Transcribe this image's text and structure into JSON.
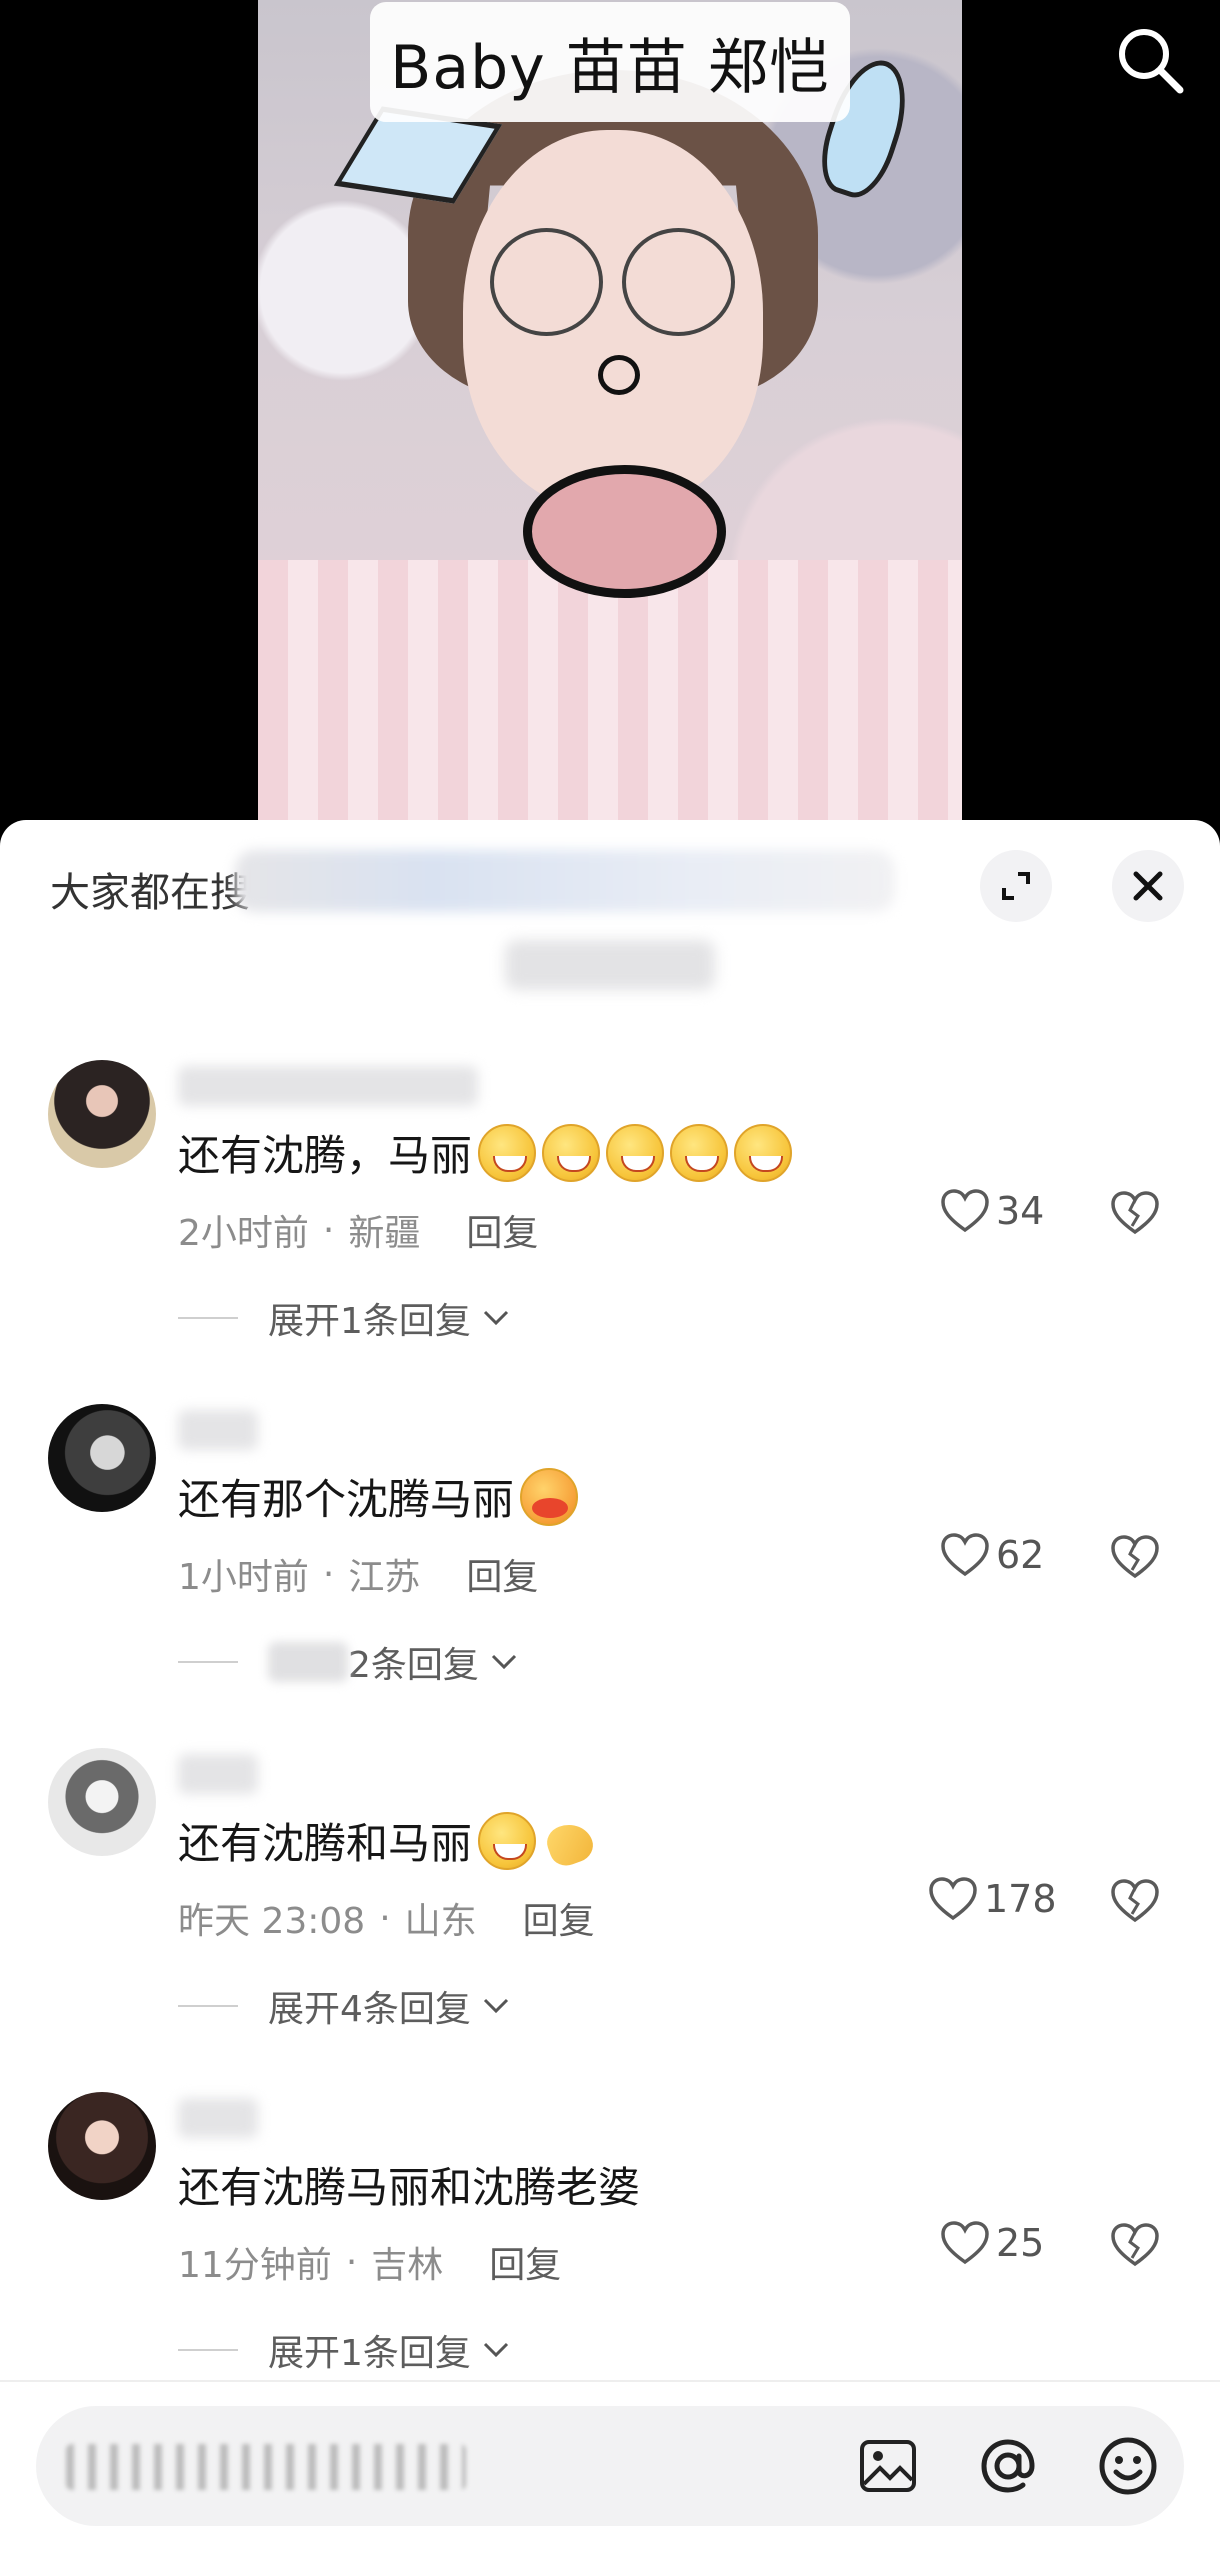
{
  "video": {
    "title": "Baby 苗苗 郑恺"
  },
  "icons": {
    "search": "search-icon",
    "expand": "expand-icon",
    "close": "close-icon",
    "like": "heart-icon",
    "dislike": "broken-heart-icon",
    "image": "image-icon",
    "at": "at-icon",
    "emoji": "smiley-icon"
  },
  "sheet": {
    "hint_prefix": "大家都在搜"
  },
  "comments": [
    {
      "text": "还有沈腾，马丽",
      "time": "2小时前",
      "location": "新疆",
      "reply_label": "回复",
      "likes": "34",
      "expand_label": "展开1条回复"
    },
    {
      "text": "还有那个沈腾马丽",
      "time": "1小时前",
      "location": "江苏",
      "reply_label": "回复",
      "likes": "62",
      "expand_label": "2条回复"
    },
    {
      "text": "还有沈腾和马丽",
      "time": "昨天 23:08",
      "location": "山东",
      "reply_label": "回复",
      "likes": "178",
      "expand_label": "展开4条回复"
    },
    {
      "text": "还有沈腾马丽和沈腾老婆",
      "time": "11分钟前",
      "location": "吉林",
      "reply_label": "回复",
      "likes": "25",
      "expand_label": "展开1条回复"
    }
  ],
  "colors": {
    "like_stroke": "#5a5a5a",
    "sheet_bg": "#ffffff",
    "meta_text": "#8c8c8c"
  }
}
